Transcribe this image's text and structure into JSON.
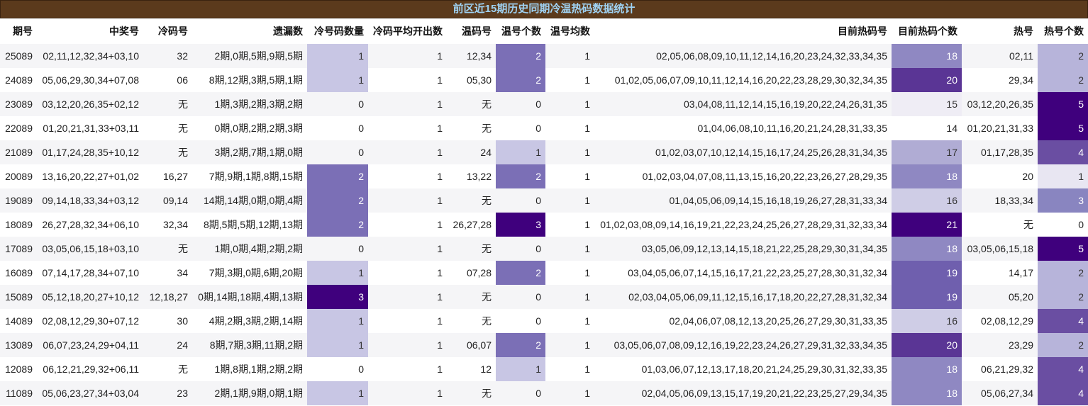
{
  "colors": {
    "title_bg": "#5b3a1c",
    "title_text": "#9fd2f3"
  },
  "chart_data": {
    "type": "table",
    "title": "前区近15期历史同期冷温热码数据统计",
    "columns": [
      "期号",
      "中奖号",
      "冷码号",
      "遗漏数",
      "冷号码数量",
      "冷码平均开出数",
      "温码号",
      "温号个数",
      "温号均数",
      "目前热码号",
      "目前热码个数",
      "热号",
      "热号个数"
    ],
    "rows": [
      [
        "25089",
        "02,11,12,32,34+03,10",
        "32",
        "2期,0期,5期,9期,5期",
        1,
        1,
        "12,34",
        2,
        1,
        "02,05,06,08,09,10,11,12,14,16,20,23,24,32,33,34,35",
        18,
        "02,11",
        2
      ],
      [
        "24089",
        "05,06,29,30,34+07,08",
        "06",
        "8期,12期,3期,5期,1期",
        1,
        1,
        "05,30",
        2,
        1,
        "01,02,05,06,07,09,10,11,12,14,16,20,22,23,28,29,30,32,34,35",
        20,
        "29,34",
        2
      ],
      [
        "23089",
        "03,12,20,26,35+02,12",
        "无",
        "1期,3期,2期,3期,2期",
        0,
        1,
        "无",
        0,
        1,
        "03,04,08,11,12,14,15,16,19,20,22,24,26,31,35",
        15,
        "03,12,20,26,35",
        5
      ],
      [
        "22089",
        "01,20,21,31,33+03,11",
        "无",
        "0期,0期,2期,2期,3期",
        0,
        1,
        "无",
        0,
        1,
        "01,04,06,08,10,11,16,20,21,24,28,31,33,35",
        14,
        "01,20,21,31,33",
        5
      ],
      [
        "21089",
        "01,17,24,28,35+10,12",
        "无",
        "3期,2期,7期,1期,0期",
        0,
        1,
        "24",
        1,
        1,
        "01,02,03,07,10,12,14,15,16,17,24,25,26,28,31,34,35",
        17,
        "01,17,28,35",
        4
      ],
      [
        "20089",
        "13,16,20,22,27+01,02",
        "16,27",
        "7期,9期,1期,8期,15期",
        2,
        1,
        "13,22",
        2,
        1,
        "01,02,03,04,07,08,11,13,15,16,20,22,23,26,27,28,29,35",
        18,
        "20",
        1
      ],
      [
        "19089",
        "09,14,18,33,34+03,12",
        "09,14",
        "14期,14期,0期,0期,4期",
        2,
        1,
        "无",
        0,
        1,
        "01,04,05,06,09,14,15,16,18,19,26,27,28,31,33,34",
        16,
        "18,33,34",
        3
      ],
      [
        "18089",
        "26,27,28,32,34+06,10",
        "32,34",
        "8期,5期,5期,12期,13期",
        2,
        1,
        "26,27,28",
        3,
        1,
        "01,02,03,08,09,14,16,19,21,22,23,24,25,26,27,28,29,31,32,33,34",
        21,
        "无",
        0
      ],
      [
        "17089",
        "03,05,06,15,18+03,10",
        "无",
        "1期,0期,4期,2期,2期",
        0,
        1,
        "无",
        0,
        1,
        "03,05,06,09,12,13,14,15,18,21,22,25,28,29,30,31,34,35",
        18,
        "03,05,06,15,18",
        5
      ],
      [
        "16089",
        "07,14,17,28,34+07,10",
        "34",
        "7期,3期,0期,6期,20期",
        1,
        1,
        "07,28",
        2,
        1,
        "03,04,05,06,07,14,15,16,17,21,22,23,25,27,28,30,31,32,34",
        19,
        "14,17",
        2
      ],
      [
        "15089",
        "05,12,18,20,27+10,12",
        "12,18,27",
        "0期,14期,18期,4期,13期",
        3,
        1,
        "无",
        0,
        1,
        "02,03,04,05,06,09,11,12,15,16,17,18,20,22,27,28,31,32,34",
        19,
        "05,20",
        2
      ],
      [
        "14089",
        "02,08,12,29,30+07,12",
        "30",
        "4期,2期,3期,2期,14期",
        1,
        1,
        "无",
        0,
        1,
        "02,04,06,07,08,12,13,20,25,26,27,29,30,31,33,35",
        16,
        "02,08,12,29",
        4
      ],
      [
        "13089",
        "06,07,23,24,29+04,11",
        "24",
        "8期,7期,3期,11期,2期",
        1,
        1,
        "06,07",
        2,
        1,
        "03,05,06,07,08,09,12,16,19,22,23,24,26,27,29,31,32,33,34,35",
        20,
        "23,29",
        2
      ],
      [
        "12089",
        "06,12,21,29,32+06,11",
        "无",
        "1期,8期,1期,2期,2期",
        0,
        1,
        "12",
        1,
        1,
        "01,03,06,07,12,13,17,18,20,21,24,25,29,30,31,32,33,35",
        18,
        "06,21,29,32",
        4
      ],
      [
        "11089",
        "05,06,23,27,34+03,04",
        "23",
        "2期,1期,9期,0期,1期",
        1,
        1,
        "无",
        0,
        1,
        "02,04,05,06,09,13,15,17,19,20,21,22,23,25,27,29,34,35",
        18,
        "05,06,27,34",
        4
      ]
    ],
    "heatmap_colors": {
      "冷号码数量": {
        "1": "#c8c6e4",
        "2": "#7b6fb6",
        "3": "#3f007d"
      },
      "温号个数": {
        "1": "#c8c6e4",
        "2": "#7b6fb6",
        "3": "#3f007d"
      },
      "目前热码个数": {
        "15": "#efedf5",
        "16": "#cfcde6",
        "17": "#b0acd4",
        "18": "#8f88c2",
        "19": "#6f5fae",
        "20": "#5a3595",
        "21": "#3f007d"
      },
      "热号个数": {
        "1": "#e8e6f2",
        "2": "#b7b4da",
        "3": "#8985c0",
        "4": "#6a4ea2",
        "5": "#3f007d"
      }
    }
  }
}
